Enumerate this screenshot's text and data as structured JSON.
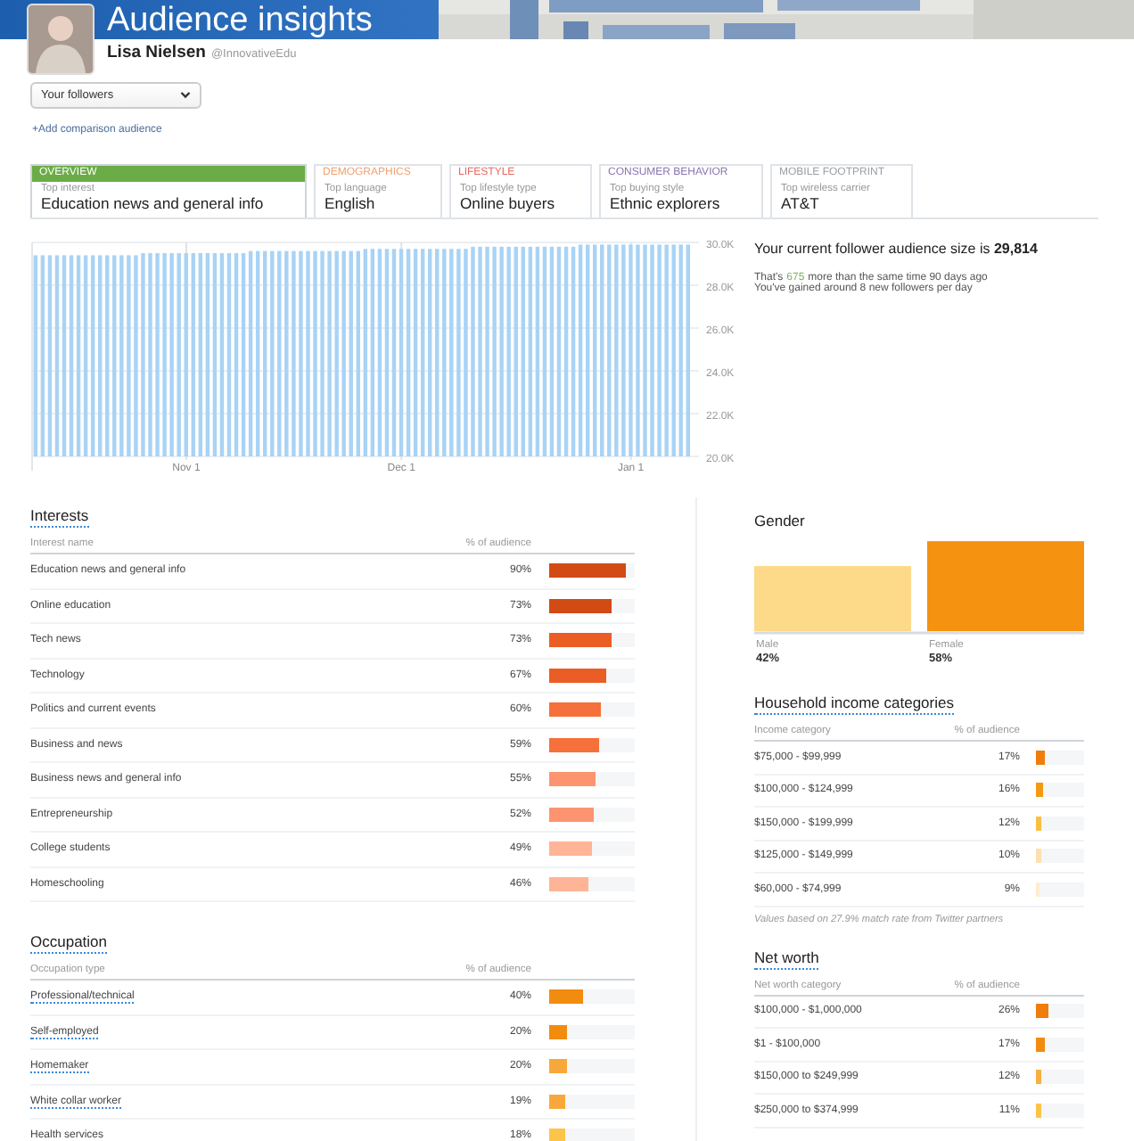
{
  "header": {
    "title": "Audience insights",
    "name": "Lisa Nielsen",
    "handle": "@InnovativeEdu"
  },
  "audience_select": {
    "value": "Your followers"
  },
  "add_comparison_link": "+Add comparison audience",
  "tabs": [
    {
      "category": "OVERVIEW",
      "color": "#6aac46",
      "caption": "Top interest",
      "value": "Education news and general info",
      "selected": true
    },
    {
      "category": "DEMOGRAPHICS",
      "color": "#f0a070",
      "caption": "Top language",
      "value": "English",
      "selected": false
    },
    {
      "category": "LIFESTYLE",
      "color": "#e5675f",
      "caption": "Top lifestyle type",
      "value": "Online buyers",
      "selected": false
    },
    {
      "category": "CONSUMER BEHAVIOR",
      "color": "#8a74b0",
      "caption": "Top buying style",
      "value": "Ethnic explorers",
      "selected": false
    },
    {
      "category": "MOBILE FOOTPRINT",
      "color": "#9aa0a6",
      "caption": "Top wireless carrier",
      "value": "AT&T",
      "selected": false
    }
  ],
  "growth": {
    "chart_data": {
      "type": "bar",
      "ylim": [
        20,
        30
      ],
      "grid": true,
      "categories": [
        null,
        null,
        null,
        null,
        null,
        null,
        null,
        null,
        null,
        null,
        null,
        null,
        null,
        null,
        null,
        null,
        null,
        null,
        null,
        null,
        null,
        "Nov 1",
        null,
        null,
        null,
        null,
        null,
        null,
        null,
        null,
        null,
        null,
        null,
        null,
        null,
        null,
        null,
        null,
        null,
        null,
        null,
        null,
        null,
        null,
        null,
        null,
        null,
        null,
        null,
        null,
        null,
        "Dec 1",
        null,
        null,
        null,
        null,
        null,
        null,
        null,
        null,
        null,
        null,
        null,
        null,
        null,
        null,
        null,
        null,
        null,
        null,
        null,
        null,
        null,
        null,
        null,
        null,
        null,
        null,
        null,
        null,
        null,
        null,
        null,
        "Jan 1",
        null,
        null,
        null,
        null,
        null,
        null,
        null,
        null
      ],
      "yticks": [
        {
          "value": 20,
          "label": "20.0K"
        },
        {
          "value": 22,
          "label": "22.0K"
        },
        {
          "value": 24,
          "label": "24.0K"
        },
        {
          "value": 26,
          "label": "26.0K"
        },
        {
          "value": 28,
          "label": "28.0K"
        },
        {
          "value": 30,
          "label": "30.0K"
        }
      ],
      "series": [
        {
          "color": "#a9d3f5",
          "values": [
            29.4,
            29.4,
            29.4,
            29.4,
            29.4,
            29.4,
            29.4,
            29.4,
            29.4,
            29.4,
            29.4,
            29.4,
            29.4,
            29.4,
            29.4,
            29.5,
            29.5,
            29.5,
            29.5,
            29.5,
            29.5,
            29.5,
            29.5,
            29.5,
            29.5,
            29.5,
            29.5,
            29.5,
            29.5,
            29.5,
            29.6,
            29.6,
            29.6,
            29.6,
            29.6,
            29.6,
            29.6,
            29.6,
            29.6,
            29.6,
            29.6,
            29.6,
            29.6,
            29.6,
            29.6,
            29.6,
            29.7,
            29.7,
            29.7,
            29.7,
            29.7,
            29.7,
            29.7,
            29.7,
            29.7,
            29.7,
            29.7,
            29.7,
            29.7,
            29.7,
            29.7,
            29.8,
            29.8,
            29.8,
            29.8,
            29.8,
            29.8,
            29.8,
            29.8,
            29.8,
            29.8,
            29.8,
            29.8,
            29.8,
            29.8,
            29.8,
            29.9,
            29.9,
            29.9,
            29.9,
            29.9,
            29.9,
            29.9,
            29.9,
            29.9,
            29.9,
            29.9,
            29.9,
            29.9,
            29.9,
            29.9,
            29.9
          ]
        }
      ]
    },
    "headline": "Your current follower audience size is **29,814**",
    "comparison_prefix": "That's",
    "change": "675",
    "comparison_suffix": "more than the same time 90 days ago",
    "daily_gain": "You've gained around 8 new followers per day"
  },
  "interests": {
    "title": "Interests",
    "name_column": "Interest name",
    "percent_column": "% of audience",
    "rows": [
      {
        "name": "Education news and general info",
        "percent": "90%",
        "level": 0.9,
        "color": "#d24a14"
      },
      {
        "name": "Online education",
        "percent": "73%",
        "level": 0.73,
        "color": "#d24a14"
      },
      {
        "name": "Tech news",
        "percent": "73%",
        "level": 0.73,
        "color": "#ea5d25"
      },
      {
        "name": "Technology",
        "percent": "67%",
        "level": 0.67,
        "color": "#ea5d25"
      },
      {
        "name": "Politics and current events",
        "percent": "60%",
        "level": 0.6,
        "color": "#f5703a"
      },
      {
        "name": "Business and news",
        "percent": "59%",
        "level": 0.59,
        "color": "#f5703a"
      },
      {
        "name": "Business news and general info",
        "percent": "55%",
        "level": 0.55,
        "color": "#fc9470"
      },
      {
        "name": "Entrepreneurship",
        "percent": "52%",
        "level": 0.52,
        "color": "#fc9470"
      },
      {
        "name": "College students",
        "percent": "49%",
        "level": 0.49,
        "color": "#feb496"
      },
      {
        "name": "Homeschooling",
        "percent": "46%",
        "level": 0.46,
        "color": "#feb496"
      }
    ]
  },
  "occupation": {
    "title": "Occupation",
    "name_column": "Occupation type",
    "percent_column": "% of audience",
    "rows": [
      {
        "name": "Professional/technical",
        "percent": "40%",
        "level": 0.4,
        "color": "#f28c0f"
      },
      {
        "name": "Self-employed",
        "percent": "20%",
        "level": 0.2,
        "color": "#f28c0f"
      },
      {
        "name": "Homemaker",
        "percent": "20%",
        "level": 0.2,
        "color": "#f8a83a"
      },
      {
        "name": "White collar worker",
        "percent": "19%",
        "level": 0.19,
        "color": "#f8a83a"
      },
      {
        "name": "Health services",
        "percent": "18%",
        "level": 0.18,
        "color": "#fcc54a"
      }
    ]
  },
  "gender": {
    "title": "Gender",
    "chart_data": {
      "type": "bar",
      "categories": [
        "Male",
        "Female"
      ],
      "series": [
        {
          "color": "#fdd98a",
          "values": [
            42,
            null
          ],
          "value_labels": [
            "42%",
            null
          ]
        },
        {
          "color": "#f5920f",
          "values": [
            null,
            58
          ],
          "value_labels": [
            null,
            "58%"
          ]
        }
      ]
    }
  },
  "household_income": {
    "title": "Household income categories",
    "name_column": "Income category",
    "percent_column": "% of audience",
    "rows": [
      {
        "name": "$75,000 - $99,999",
        "percent": "17%",
        "level": 0.17,
        "color": "#f07d0a"
      },
      {
        "name": "$100,000 - $124,999",
        "percent": "16%",
        "level": 0.16,
        "color": "#f59a10"
      },
      {
        "name": "$150,000 - $199,999",
        "percent": "12%",
        "level": 0.12,
        "color": "#f8c040"
      },
      {
        "name": "$125,000 - $149,999",
        "percent": "10%",
        "level": 0.1,
        "color": "#fde0b0"
      },
      {
        "name": "$60,000 - $74,999",
        "percent": "9%",
        "level": 0.09,
        "color": "#fdecd0"
      }
    ],
    "note": "Values based on 27.9% match rate from Twitter partners"
  },
  "net_worth": {
    "title": "Net worth",
    "name_column": "Net worth category",
    "percent_column": "% of audience",
    "rows": [
      {
        "name": "$100,000 - $1,000,000",
        "percent": "26%",
        "level": 0.26,
        "color": "#f07d0a"
      },
      {
        "name": "$1 - $100,000",
        "percent": "17%",
        "level": 0.17,
        "color": "#f28c0f"
      },
      {
        "name": "$150,000 to $249,999",
        "percent": "12%",
        "level": 0.12,
        "color": "#f8b040"
      },
      {
        "name": "$250,000 to $374,999",
        "percent": "11%",
        "level": 0.11,
        "color": "#fcc54a"
      }
    ]
  }
}
